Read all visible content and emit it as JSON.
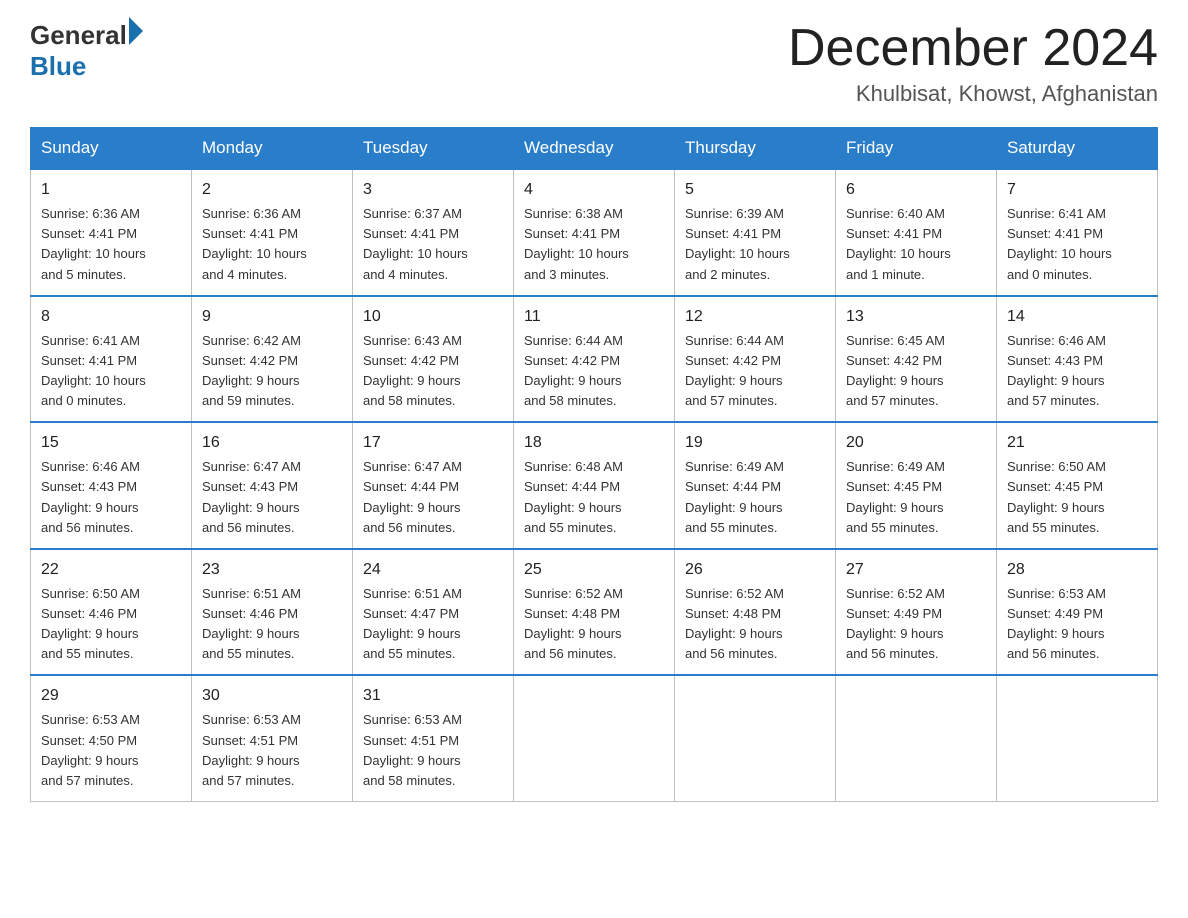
{
  "header": {
    "logo_general": "General",
    "logo_blue": "Blue",
    "title": "December 2024",
    "subtitle": "Khulbisat, Khowst, Afghanistan"
  },
  "days_of_week": [
    "Sunday",
    "Monday",
    "Tuesday",
    "Wednesday",
    "Thursday",
    "Friday",
    "Saturday"
  ],
  "weeks": [
    [
      {
        "day": "1",
        "info": "Sunrise: 6:36 AM\nSunset: 4:41 PM\nDaylight: 10 hours\nand 5 minutes."
      },
      {
        "day": "2",
        "info": "Sunrise: 6:36 AM\nSunset: 4:41 PM\nDaylight: 10 hours\nand 4 minutes."
      },
      {
        "day": "3",
        "info": "Sunrise: 6:37 AM\nSunset: 4:41 PM\nDaylight: 10 hours\nand 4 minutes."
      },
      {
        "day": "4",
        "info": "Sunrise: 6:38 AM\nSunset: 4:41 PM\nDaylight: 10 hours\nand 3 minutes."
      },
      {
        "day": "5",
        "info": "Sunrise: 6:39 AM\nSunset: 4:41 PM\nDaylight: 10 hours\nand 2 minutes."
      },
      {
        "day": "6",
        "info": "Sunrise: 6:40 AM\nSunset: 4:41 PM\nDaylight: 10 hours\nand 1 minute."
      },
      {
        "day": "7",
        "info": "Sunrise: 6:41 AM\nSunset: 4:41 PM\nDaylight: 10 hours\nand 0 minutes."
      }
    ],
    [
      {
        "day": "8",
        "info": "Sunrise: 6:41 AM\nSunset: 4:41 PM\nDaylight: 10 hours\nand 0 minutes."
      },
      {
        "day": "9",
        "info": "Sunrise: 6:42 AM\nSunset: 4:42 PM\nDaylight: 9 hours\nand 59 minutes."
      },
      {
        "day": "10",
        "info": "Sunrise: 6:43 AM\nSunset: 4:42 PM\nDaylight: 9 hours\nand 58 minutes."
      },
      {
        "day": "11",
        "info": "Sunrise: 6:44 AM\nSunset: 4:42 PM\nDaylight: 9 hours\nand 58 minutes."
      },
      {
        "day": "12",
        "info": "Sunrise: 6:44 AM\nSunset: 4:42 PM\nDaylight: 9 hours\nand 57 minutes."
      },
      {
        "day": "13",
        "info": "Sunrise: 6:45 AM\nSunset: 4:42 PM\nDaylight: 9 hours\nand 57 minutes."
      },
      {
        "day": "14",
        "info": "Sunrise: 6:46 AM\nSunset: 4:43 PM\nDaylight: 9 hours\nand 57 minutes."
      }
    ],
    [
      {
        "day": "15",
        "info": "Sunrise: 6:46 AM\nSunset: 4:43 PM\nDaylight: 9 hours\nand 56 minutes."
      },
      {
        "day": "16",
        "info": "Sunrise: 6:47 AM\nSunset: 4:43 PM\nDaylight: 9 hours\nand 56 minutes."
      },
      {
        "day": "17",
        "info": "Sunrise: 6:47 AM\nSunset: 4:44 PM\nDaylight: 9 hours\nand 56 minutes."
      },
      {
        "day": "18",
        "info": "Sunrise: 6:48 AM\nSunset: 4:44 PM\nDaylight: 9 hours\nand 55 minutes."
      },
      {
        "day": "19",
        "info": "Sunrise: 6:49 AM\nSunset: 4:44 PM\nDaylight: 9 hours\nand 55 minutes."
      },
      {
        "day": "20",
        "info": "Sunrise: 6:49 AM\nSunset: 4:45 PM\nDaylight: 9 hours\nand 55 minutes."
      },
      {
        "day": "21",
        "info": "Sunrise: 6:50 AM\nSunset: 4:45 PM\nDaylight: 9 hours\nand 55 minutes."
      }
    ],
    [
      {
        "day": "22",
        "info": "Sunrise: 6:50 AM\nSunset: 4:46 PM\nDaylight: 9 hours\nand 55 minutes."
      },
      {
        "day": "23",
        "info": "Sunrise: 6:51 AM\nSunset: 4:46 PM\nDaylight: 9 hours\nand 55 minutes."
      },
      {
        "day": "24",
        "info": "Sunrise: 6:51 AM\nSunset: 4:47 PM\nDaylight: 9 hours\nand 55 minutes."
      },
      {
        "day": "25",
        "info": "Sunrise: 6:52 AM\nSunset: 4:48 PM\nDaylight: 9 hours\nand 56 minutes."
      },
      {
        "day": "26",
        "info": "Sunrise: 6:52 AM\nSunset: 4:48 PM\nDaylight: 9 hours\nand 56 minutes."
      },
      {
        "day": "27",
        "info": "Sunrise: 6:52 AM\nSunset: 4:49 PM\nDaylight: 9 hours\nand 56 minutes."
      },
      {
        "day": "28",
        "info": "Sunrise: 6:53 AM\nSunset: 4:49 PM\nDaylight: 9 hours\nand 56 minutes."
      }
    ],
    [
      {
        "day": "29",
        "info": "Sunrise: 6:53 AM\nSunset: 4:50 PM\nDaylight: 9 hours\nand 57 minutes."
      },
      {
        "day": "30",
        "info": "Sunrise: 6:53 AM\nSunset: 4:51 PM\nDaylight: 9 hours\nand 57 minutes."
      },
      {
        "day": "31",
        "info": "Sunrise: 6:53 AM\nSunset: 4:51 PM\nDaylight: 9 hours\nand 58 minutes."
      },
      {
        "day": "",
        "info": ""
      },
      {
        "day": "",
        "info": ""
      },
      {
        "day": "",
        "info": ""
      },
      {
        "day": "",
        "info": ""
      }
    ]
  ]
}
